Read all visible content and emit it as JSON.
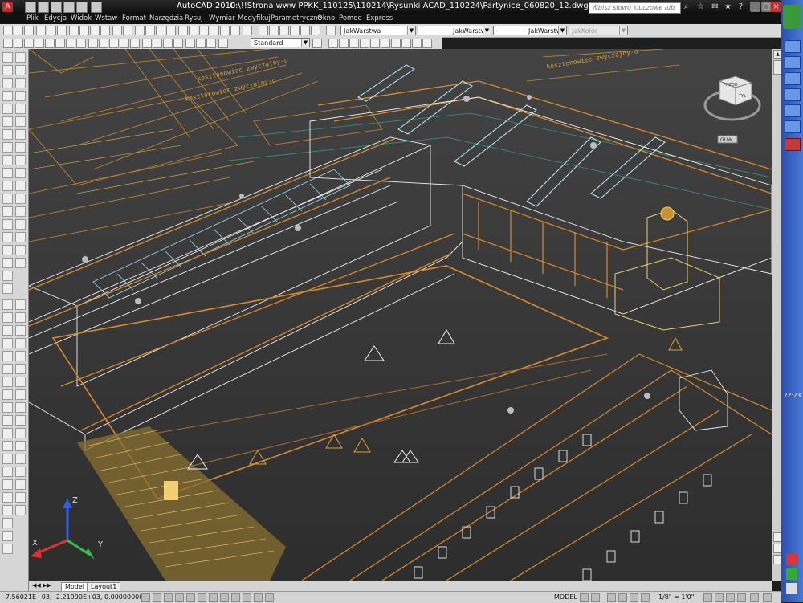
{
  "titlebar": {
    "app": "AutoCAD 2010",
    "path": "C:\\!!Strona www PPKK_110125\\110214\\Rysunki ACAD_110224\\Partynice_060820_12.dwg",
    "search_placeholder": "Wpisz słowo kluczowe lub frazę"
  },
  "menu": [
    "Plik",
    "Edycja",
    "Widok",
    "Wstaw",
    "Format",
    "Narzędzia",
    "Rysuj",
    "Wymiar",
    "Modyfikuj",
    "Parametryczne",
    "Okno",
    "Pomoc",
    "Express"
  ],
  "toolbar": {
    "text_style": "Standard",
    "layer": "JakWarstwa",
    "linetype": "JakWarstwa",
    "lineweight": "JakWarstwa",
    "plotstyle": "JakKolor"
  },
  "viewcube": {
    "top_label": "PRZÓD",
    "side_label": "TYŁ",
    "wcs_label": "GUW"
  },
  "canvas_labels": [
    "kosztorowiec zwyczajny-o",
    "kosztonowiec zwyczajny-o",
    "kosztonowiec zwyczajny-o"
  ],
  "ucs": {
    "x": "X",
    "y": "Y",
    "z": "Z"
  },
  "tabs": [
    "Model",
    "Layout1"
  ],
  "status": {
    "coords": "-7.56021E+03, -2.21990E+03, 0.00000000",
    "model": "MODEL",
    "scale": "1/8\" = 1'0\""
  },
  "clock": "22:23",
  "colors": {
    "accent_orange": "#d98a2a",
    "wire_white": "#f0f0f0",
    "wire_cyan": "#9fe0f0",
    "canvas_bg": "#3a3a3a"
  }
}
